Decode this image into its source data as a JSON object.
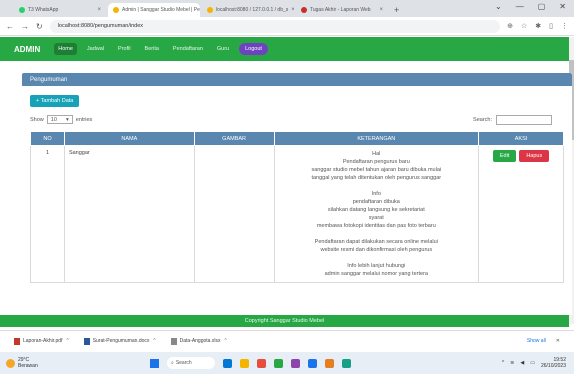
{
  "browser": {
    "tabs": [
      {
        "label": "T3 WhatsApp",
        "color": "#25d366",
        "active": false
      },
      {
        "label": "Admin | Sanggar Studio Mebel | Pe",
        "color": "#f4b400",
        "active": true
      },
      {
        "label": "localhost:8080 / 127.0.0.1 / db_s",
        "color": "#f4b400",
        "active": false
      },
      {
        "label": "Tugas Akhir - Laporan Web",
        "color": "#c4302b",
        "active": false
      }
    ],
    "new_tab": "+",
    "window_controls": [
      "⌄",
      "—",
      "▢",
      "✕"
    ],
    "url": "localhost:8080/pengumuman/index"
  },
  "navbar": {
    "brand": "ADMIN",
    "links": [
      "Home",
      "Jadwal",
      "Profil",
      "Berita",
      "Pendaftaran",
      "Guru"
    ],
    "active_index": 0,
    "logout": "Logout",
    "color": "#28a745"
  },
  "card": {
    "header": "Pengumuman",
    "add_button": "+ Tambah Data",
    "show_label": "Show",
    "show_value": "10",
    "entries_label": "entries",
    "search_label": "Search:"
  },
  "table": {
    "columns": [
      "NO",
      "NAMA",
      "GAMBAR",
      "KETERANGAN",
      "AKSI"
    ],
    "rows": [
      {
        "no": "1",
        "nama": "Sanggar",
        "gambar": "",
        "keterangan": [
          "Hal",
          "Pendaftaran pengurus baru",
          "sanggar studio mebel tahun ajaran baru dibuka mulai",
          "tanggal yang telah ditentukan oleh pengurus sanggar",
          "",
          "Info",
          "pendaftaran dibuka",
          "silahkan datang langsung ke sekretariat",
          "syarat",
          "membawa fotokopi identitas dan pas foto terbaru",
          "",
          "Pendaftaran dapat dilakukan secara online melalui",
          "website resmi dan dikonfirmasi oleh pengurus",
          "",
          "Info lebih lanjut hubungi",
          "admin sanggar melalui nomor yang tertera"
        ],
        "edit": "Edit",
        "delete": "Hapus"
      }
    ]
  },
  "footer": {
    "text": "Copyright Sanggar Studio Mebel"
  },
  "downloads": {
    "items": [
      {
        "label": "Laporan-Akhir.pdf",
        "kind": "pdf"
      },
      {
        "label": "Surat-Pengumuman.docx",
        "kind": "doc"
      },
      {
        "label": "Data-Anggota.xlsx",
        "kind": "gray"
      }
    ],
    "show_all": "Show all",
    "close": "✕"
  },
  "taskbar": {
    "weather_temp": "29°C",
    "weather_desc": "Berawan",
    "search_placeholder": "Search",
    "app_colors": [
      "#0078d4",
      "#f4b400",
      "#e74c3c",
      "#28a745",
      "#8e44ad",
      "#1a73e8",
      "#e67e22",
      "#16a085"
    ],
    "time": "19:52",
    "date": "26/10/2023"
  }
}
